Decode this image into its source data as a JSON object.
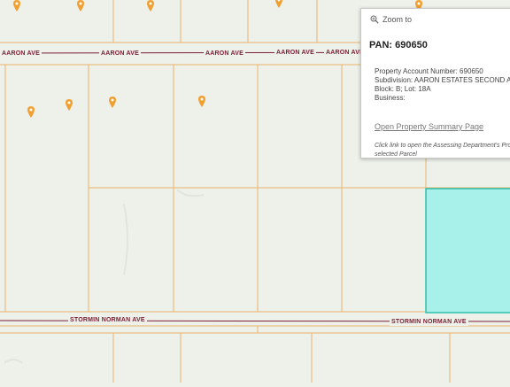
{
  "roads": {
    "aaron_label": "AARON AVE",
    "stormin_label": "STORMIN NORMAN AVE"
  },
  "map": {
    "background": "#eef0ea",
    "parcel_line_color": "#e8b56a",
    "road_line_color": "#7a1f33",
    "selected_parcel_fill": "#a8f0ea",
    "selected_parcel_stroke": "#2fbfae",
    "marker_color": "#f0a030",
    "marker_icon": "map-pin-icon"
  },
  "popup": {
    "zoom_label": "Zoom to",
    "title": "PAN: 690650",
    "account_line": "Property Account Number: 690650",
    "subdivision_line": "Subdivision: AARON ESTATES SECOND ADDITION",
    "block_line": "Block: B;  Lot:  18A",
    "business_line": "Business:",
    "link_text": "Open Property Summary Page",
    "note_line1": "Click link to open the Assessing Department's Property Summary page for the",
    "note_line2": "selected Parcel"
  }
}
